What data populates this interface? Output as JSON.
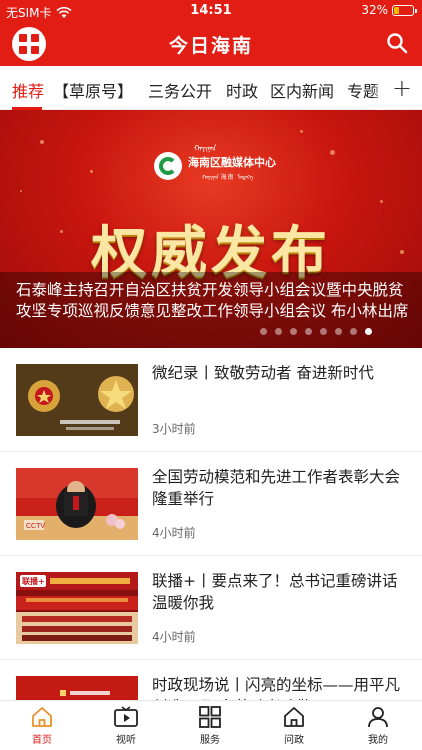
{
  "status_bar": {
    "carrier": "无SIM卡",
    "time": "14:51",
    "battery": "32%",
    "battery_level": 0.32
  },
  "header": {
    "title": "今日海南",
    "menu_icon": "grid-menu-icon",
    "search_icon": "search-icon"
  },
  "tabs": {
    "items": [
      "推荐",
      "【草原号】",
      "三务公开",
      "时政",
      "区内新闻",
      "专题"
    ],
    "active_index": 0,
    "add_icon": "+"
  },
  "banner": {
    "logo_name": "海南区融媒体中心",
    "logo_mongol": "ᠬᠠᠶᠢᠨᠠᠨ",
    "logo_sub": "ᠬᠠᠶᠢᠨᠠᠨ 海南 ᠮᠡᠳᠡᠭᠡ",
    "headline_art": "权威发布",
    "caption": "石泰峰主持召开自治区扶贫开发领导小组会议暨中央脱贫攻坚专项巡视反馈意见整改工作领导小组会议 布小林出席",
    "slide_count": 8,
    "active_slide": 7
  },
  "news": [
    {
      "title": "微纪录丨致敬劳动者 奋进新时代",
      "time": "3小时前"
    },
    {
      "title": "全国劳动模范和先进工作者表彰大会隆重举行",
      "time": "4小时前"
    },
    {
      "title": "联播+丨要点来了！总书记重磅讲话温暖你我",
      "time": "4小时前"
    },
    {
      "title": "时政现场说丨闪亮的坐标——用平凡创造不凡 向劳动者致敬",
      "time": ""
    }
  ],
  "thumb_text": {
    "item1_caption": "全国劳动模范和先进工作者表彰大会",
    "item3_badge": "联播+",
    "item3_tv": "CCTV"
  },
  "bottom_nav": [
    {
      "label": "首页",
      "icon": "home-icon"
    },
    {
      "label": "视听",
      "icon": "video-icon"
    },
    {
      "label": "服务",
      "icon": "services-grid-icon"
    },
    {
      "label": "问政",
      "icon": "inquiry-house-icon"
    },
    {
      "label": "我的",
      "icon": "profile-icon"
    }
  ],
  "colors": {
    "brand_red": "#e11d14",
    "gold_text": "#fbe6a3"
  }
}
